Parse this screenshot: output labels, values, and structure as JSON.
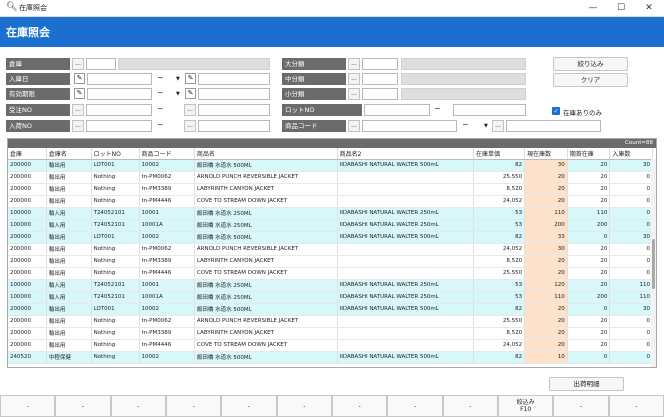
{
  "window": {
    "title": "在庫照会",
    "min": "—",
    "max": "☐",
    "close": "✕"
  },
  "header": {
    "title": "在庫照会"
  },
  "filters": {
    "warehouse": "倉庫",
    "received_date": "入庫日",
    "expiry_date": "有効期限",
    "order_no": "受注NO",
    "receipt_no": "入荷NO",
    "category_large": "大分類",
    "category_medium": "中分類",
    "category_small": "小分類",
    "lot_no": "ロットNO",
    "product_code": "商品コード",
    "search_btn": "...",
    "tilde": "~",
    "dropdown": "▼"
  },
  "buttons": {
    "filter": "絞り込み",
    "clear": "クリア",
    "shipment_detail": "出荷明細"
  },
  "stock_only": {
    "label": "在庫ありのみ",
    "checked": true
  },
  "grid": {
    "count": "Count=88",
    "columns": [
      "倉庫",
      "倉庫名",
      "ロットNO",
      "商品コード",
      "商品名",
      "商品名2",
      "在庫単価",
      "現在庫数",
      "期首在庫",
      "入庫数"
    ],
    "rows": [
      [
        "200000",
        "輸出用",
        "LOT001",
        "10002",
        "飯田橋 水道水 500ML",
        "IIDABASHI NATURAL WALTER 500mL",
        "82",
        "30",
        "20",
        "30"
      ],
      [
        "200000",
        "輸出用",
        "Nothing",
        "tn-PM0062",
        "ARNOLD PUNCH REVERSIBLE JACKET",
        "",
        "25,550",
        "20",
        "20",
        "0"
      ],
      [
        "200000",
        "輸出用",
        "Nothing",
        "tn-PM3389",
        "LABYRINTH CANYON JACKET",
        "",
        "8,520",
        "20",
        "20",
        "0"
      ],
      [
        "200000",
        "輸出用",
        "Nothing",
        "tn-PM4446",
        "COVE TO STREAM DOWN JACKET",
        "",
        "24,052",
        "20",
        "20",
        "0"
      ],
      [
        "100000",
        "輸入用",
        "T24052101",
        "10001",
        "飯田橋 水道水 250ML",
        "IIDABASHI NATURAL WALTER 250mL",
        "53",
        "110",
        "110",
        "0"
      ],
      [
        "100000",
        "輸入用",
        "T24052101",
        "10001A",
        "飯田橋 水道水 250ML",
        "IIDABASHI NATURAL WALTER 250mL",
        "53",
        "200",
        "200",
        "0"
      ],
      [
        "200000",
        "輸出用",
        "LOT001",
        "10002",
        "飯田橋 水道水 500ML",
        "IIDABASHI NATURAL WALTER 500mL",
        "82",
        "33",
        "0",
        "30"
      ],
      [
        "200000",
        "輸出用",
        "Nothing",
        "tn-PM0062",
        "ARNOLD PUNCH REVERSIBLE JACKET",
        "",
        "24,052",
        "30",
        "20",
        "0"
      ],
      [
        "200000",
        "輸出用",
        "Nothing",
        "tn-PM3389",
        "LABYRINTH CANYON JACKET",
        "",
        "8,520",
        "20",
        "20",
        "0"
      ],
      [
        "200000",
        "輸出用",
        "Nothing",
        "tn-PM4446",
        "COVE TO STREAM DOWN JACKET",
        "",
        "25,550",
        "20",
        "20",
        "0"
      ],
      [
        "100000",
        "輸入用",
        "T24052101",
        "10001",
        "飯田橋 水道水 250ML",
        "IIDABASHI NATURAL WALTER 250mL",
        "53",
        "120",
        "20",
        "110"
      ],
      [
        "100000",
        "輸入用",
        "T24052101",
        "10001A",
        "飯田橋 水道水 250ML",
        "IIDABASHI NATURAL WALTER 250mL",
        "53",
        "110",
        "200",
        "110"
      ],
      [
        "200000",
        "輸出用",
        "LOT001",
        "10002",
        "飯田橋 水道水 500ML",
        "IIDABASHI NATURAL WALTER 500mL",
        "82",
        "20",
        "0",
        "30"
      ],
      [
        "200000",
        "輸出用",
        "Nothing",
        "tn-PM0062",
        "ARNOLD PUNCH REVERSIBLE JACKET",
        "",
        "25,550",
        "20",
        "20",
        "0"
      ],
      [
        "200000",
        "輸出用",
        "Nothing",
        "tn-PM3389",
        "LABYRINTH CANYON JACKET",
        "",
        "8,520",
        "20",
        "20",
        "0"
      ],
      [
        "200000",
        "輸出用",
        "Nothing",
        "tn-PM4446",
        "COVE TO STREAM DOWN JACKET",
        "",
        "24,052",
        "20",
        "20",
        "0"
      ],
      [
        "240520",
        "中程保健",
        "Nothing",
        "10002",
        "飯田橋 水道水 500ML",
        "IIDABASHI NATURAL WALTER 500mL",
        "82",
        "10",
        "0",
        "0"
      ]
    ]
  },
  "fkeys": [
    {
      "top": "",
      "bottom": "-"
    },
    {
      "top": "",
      "bottom": "-"
    },
    {
      "top": "",
      "bottom": "-"
    },
    {
      "top": "",
      "bottom": "-"
    },
    {
      "top": "",
      "bottom": "-"
    },
    {
      "top": "",
      "bottom": "-"
    },
    {
      "top": "",
      "bottom": "-"
    },
    {
      "top": "",
      "bottom": "-"
    },
    {
      "top": "",
      "bottom": "-"
    },
    {
      "top": "絞込み",
      "bottom": "F10"
    },
    {
      "top": "",
      "bottom": "-"
    },
    {
      "top": "",
      "bottom": "-"
    }
  ],
  "colors": {
    "accent": "#1a6fcf",
    "label_bg": "#6b6b6b",
    "row_cyan": "#d8f7fb",
    "stock_peach": "#fde1c9"
  }
}
